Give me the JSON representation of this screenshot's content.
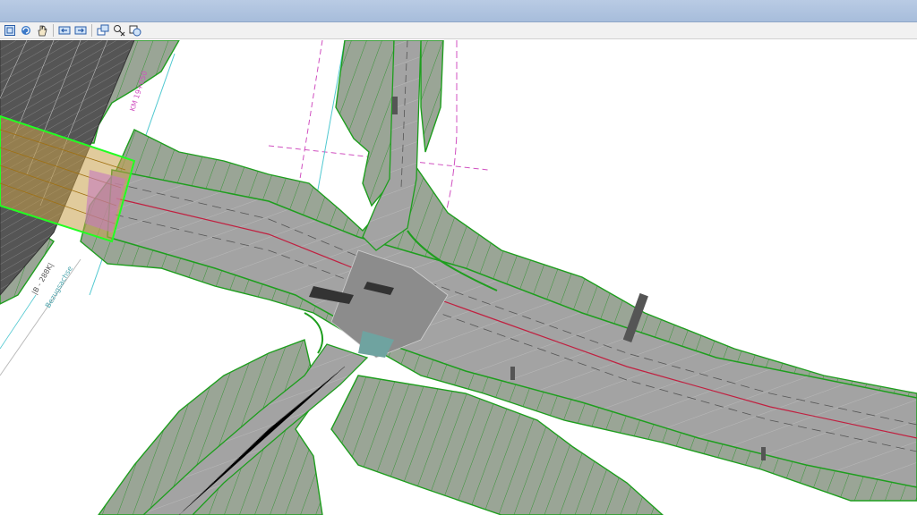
{
  "window": {
    "title": ""
  },
  "toolbar": {
    "buttons": [
      {
        "name": "fit-view-button",
        "icon": "fit-view-icon"
      },
      {
        "name": "rotate-view-button",
        "icon": "rotate-view-icon"
      },
      {
        "name": "pan-view-button",
        "icon": "pan-hand-icon"
      },
      {
        "name": "previous-view-button",
        "icon": "previous-view-icon"
      },
      {
        "name": "next-view-button",
        "icon": "next-view-icon"
      },
      {
        "name": "copy-view-button",
        "icon": "copy-view-icon"
      },
      {
        "name": "clip-volume-button",
        "icon": "clip-volume-icon"
      },
      {
        "name": "view-attributes-button",
        "icon": "view-attributes-icon"
      }
    ]
  },
  "drawing": {
    "labels": {
      "road_north": "KM 19+050",
      "road_west": "|B - 288K|",
      "road_west_sub": "Bezugsachse"
    },
    "colors": {
      "road": "#9a9a9a",
      "slope": "#9aa596",
      "outline": "#1e9e1e",
      "bright_outline": "#22ff22",
      "centerline": "#c02040",
      "axis_pink": "#d050c0",
      "axis_cyan": "#50c8d0",
      "bridge": "#d4a020"
    }
  }
}
